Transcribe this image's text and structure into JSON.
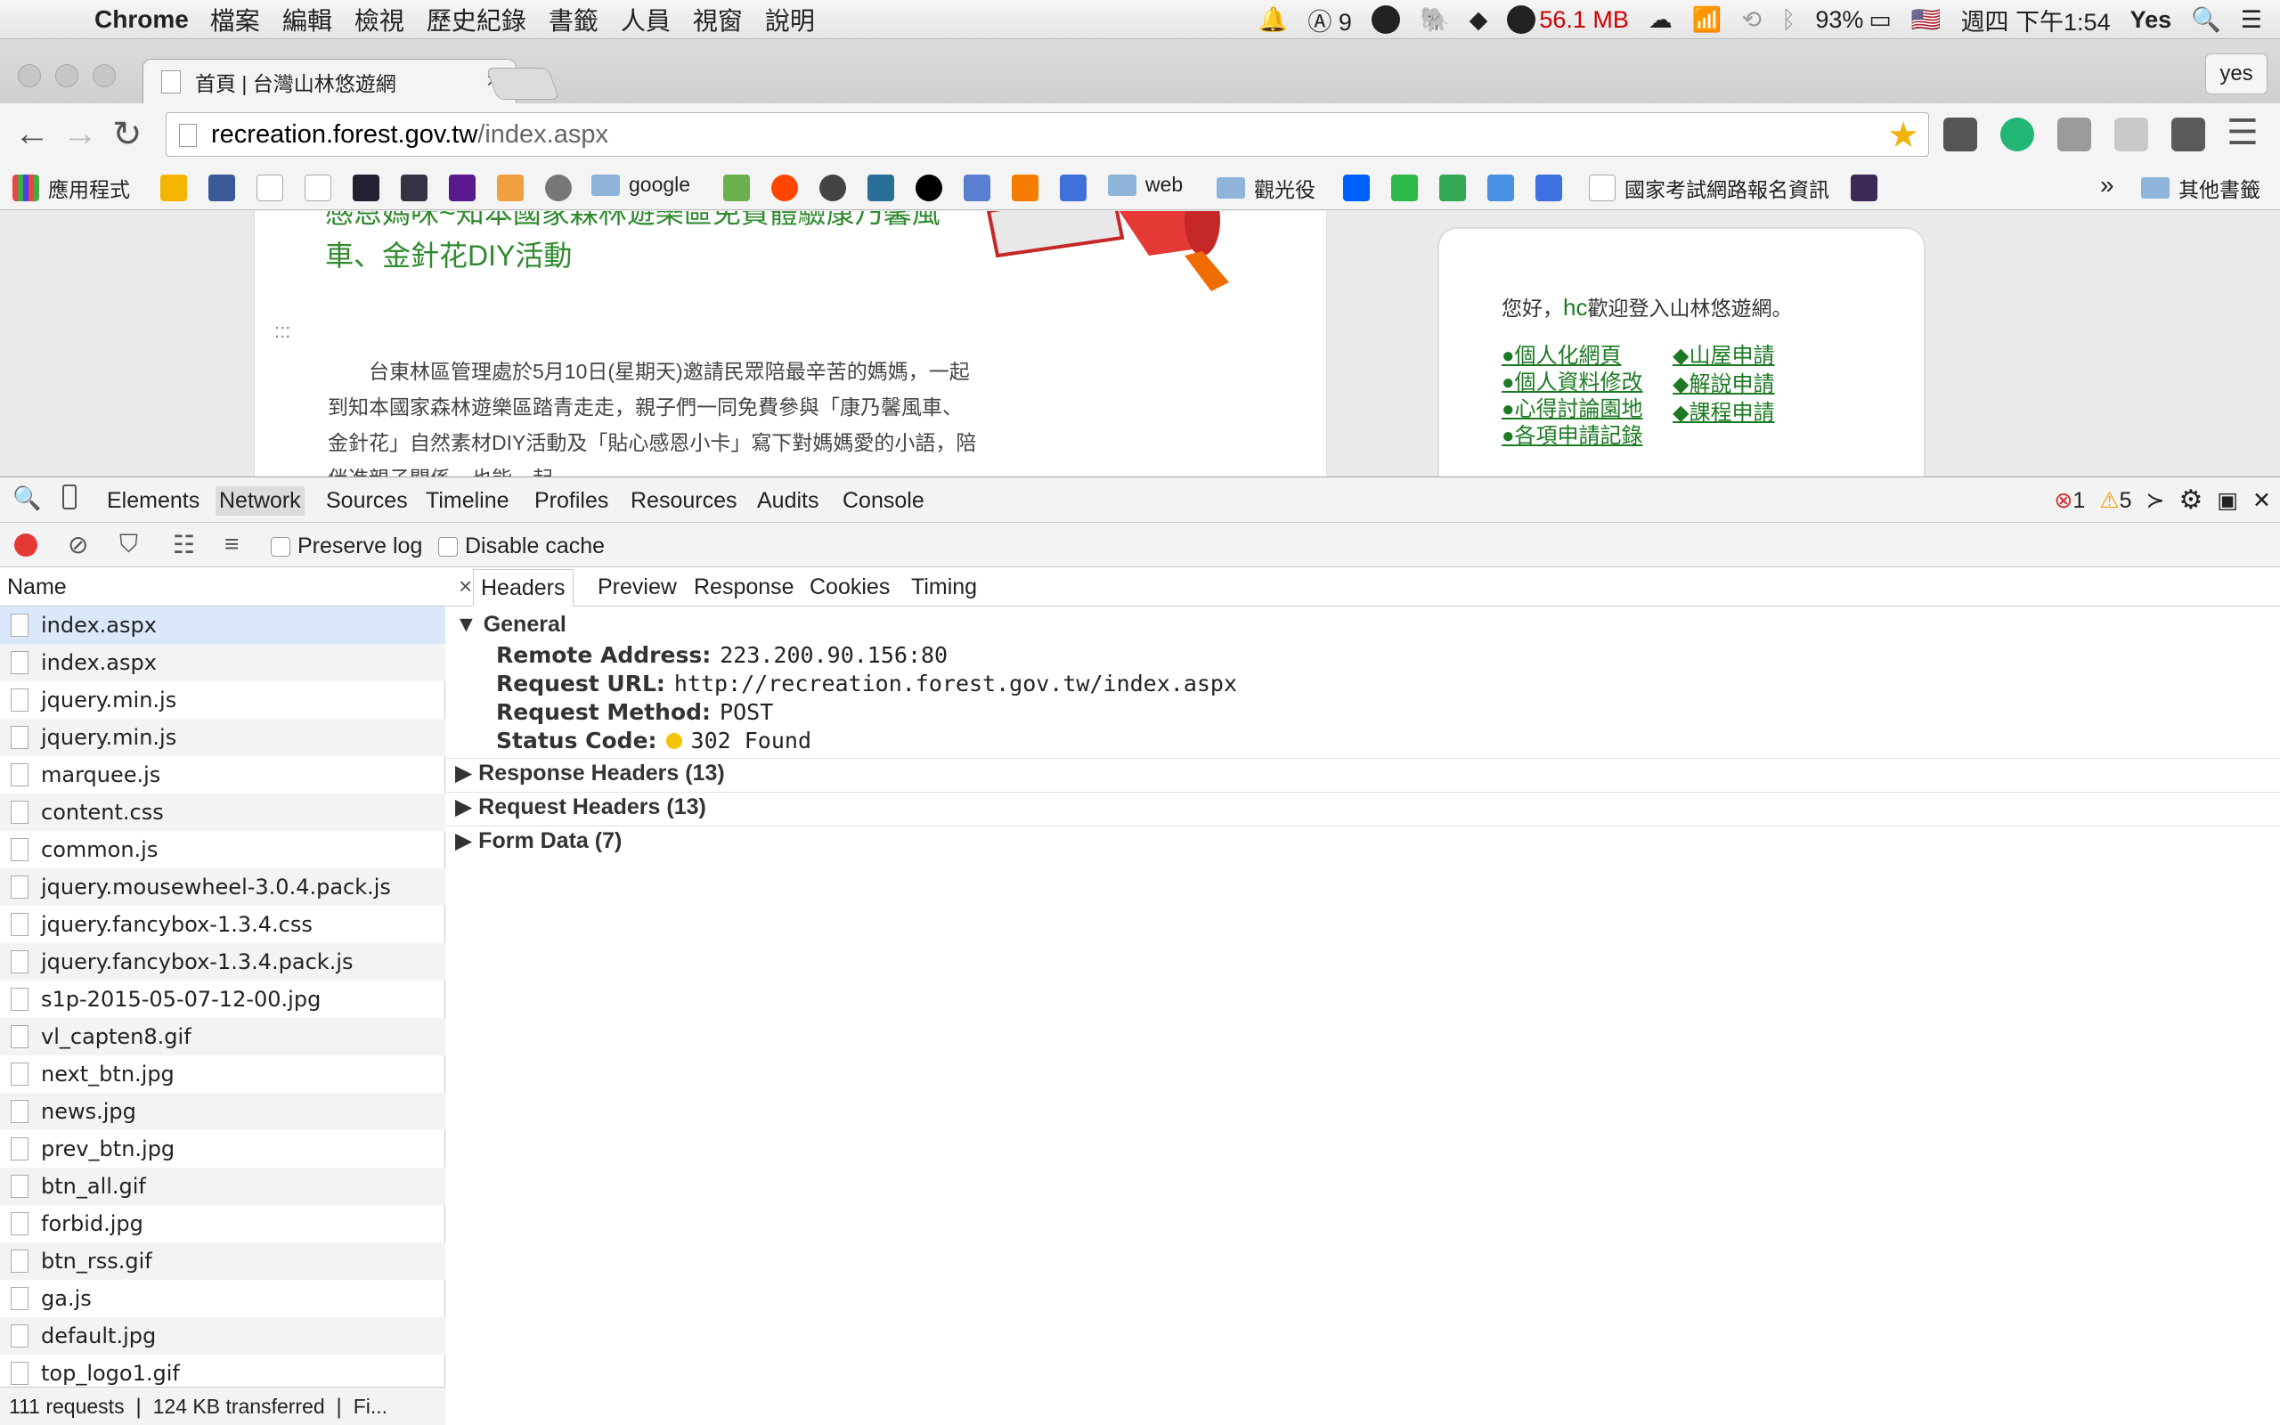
{
  "menubar": {
    "app": "Chrome",
    "items": [
      "檔案",
      "編輯",
      "檢視",
      "歷史紀錄",
      "書籤",
      "人員",
      "視窗",
      "說明"
    ],
    "status": {
      "adobe_count": "9",
      "memory": "56.1 MB",
      "battery": "93%",
      "datetime": "週四 下午1:54",
      "user": "Yes"
    }
  },
  "browser": {
    "tab_title": "首頁 | 台灣山林悠遊網",
    "profile": "yes",
    "url_host": "recreation.forest.gov.tw",
    "url_path": "/index.aspx",
    "bookmarks": [
      "應用程式",
      "google",
      "web",
      "觀光役",
      "國家考試網路報名資訊",
      "其他書籤"
    ]
  },
  "webpage": {
    "news_title": "感恩媽咪~知本國家森林遊樂區免費體驗康乃馨風車、金針花DIY活動",
    "dots": ":::",
    "article": "台東林區管理處於5月10日(星期天)邀請民眾陪最辛苦的媽媽，一起到知本國家森林遊樂區踏青走走，親子們一同免費參與「康乃馨風車、金針花」自然素材DIY活動及「貼心感恩小卡」寫下對媽媽愛的小語，陪伴進親子關係，也能一起",
    "greeting_pre": "您好，",
    "greeting_user": "hc",
    "greeting_post": "歡迎登入山林悠遊網。",
    "links_left": [
      "●個人化網頁",
      "●個人資料修改",
      "●心得討論園地",
      "●各項申請記錄"
    ],
    "links_right": [
      "◆山屋申請",
      "◆解說申請",
      "◆課程申請"
    ]
  },
  "devtools": {
    "tabs": [
      "Elements",
      "Network",
      "Sources",
      "Timeline",
      "Profiles",
      "Resources",
      "Audits",
      "Console"
    ],
    "errors": "1",
    "warnings": "5",
    "preserve_log": "Preserve log",
    "disable_cache": "Disable cache",
    "name_header": "Name",
    "requests": [
      "index.aspx",
      "index.aspx",
      "jquery.min.js",
      "jquery.min.js",
      "marquee.js",
      "content.css",
      "common.js",
      "jquery.mousewheel-3.0.4.pack.js",
      "jquery.fancybox-1.3.4.css",
      "jquery.fancybox-1.3.4.pack.js",
      "s1p-2015-05-07-12-00.jpg",
      "vl_capten8.gif",
      "next_btn.jpg",
      "news.jpg",
      "prev_btn.jpg",
      "btn_all.gif",
      "forbid.jpg",
      "btn_rss.gif",
      "ga.js",
      "default.jpg",
      "top_logo1.gif"
    ],
    "summary": "111 requests ❘ 124 KB transferred ❘ Fi...",
    "detail_tabs": [
      "Headers",
      "Preview",
      "Response",
      "Cookies",
      "Timing"
    ],
    "general": {
      "title": "General",
      "remote_address_label": "Remote Address:",
      "remote_address": "223.200.90.156:80",
      "request_url_label": "Request URL:",
      "request_url": "http://recreation.forest.gov.tw/index.aspx",
      "request_method_label": "Request Method:",
      "request_method": "POST",
      "status_code_label": "Status Code:",
      "status_code": "302 Found"
    },
    "sections": [
      "Response Headers (13)",
      "Request Headers (13)",
      "Form Data (7)"
    ]
  }
}
